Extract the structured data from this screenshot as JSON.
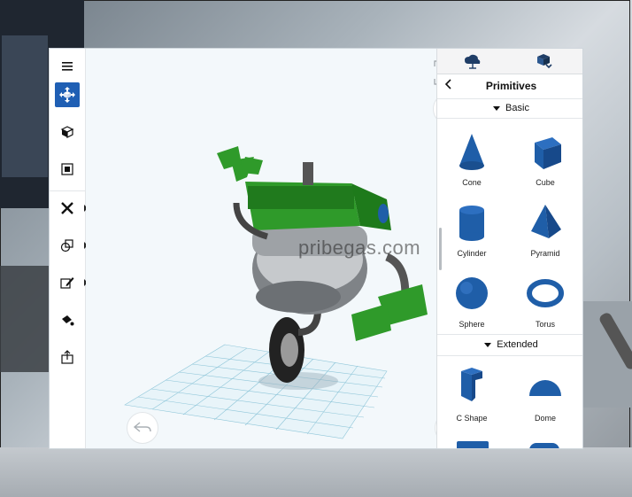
{
  "toolbar": {
    "items": [
      {
        "icon": "menu-icon"
      },
      {
        "icon": "move-icon",
        "active": true
      },
      {
        "icon": "rotate-icon"
      },
      {
        "icon": "scale-icon"
      },
      {
        "icon": "transform-tools-icon",
        "has_submenu": true
      },
      {
        "icon": "combine-icon",
        "has_submenu": true
      },
      {
        "icon": "edit-pen-icon",
        "has_submenu": true
      },
      {
        "icon": "paint-icon"
      },
      {
        "icon": "export-icon"
      }
    ]
  },
  "viewport": {
    "watermark": "pribegas.com",
    "view_cube_icon": "view-cube-icon",
    "undo_icon": "undo-icon",
    "redo_icon": "redo-icon"
  },
  "panel": {
    "tabs": [
      {
        "icon": "cloud-icon"
      },
      {
        "icon": "download-box-icon"
      }
    ],
    "title": "Primitives",
    "basic_label": "Basic",
    "extended_label": "Extended",
    "basic_items": [
      {
        "label": "Cone",
        "icon": "cone-icon"
      },
      {
        "label": "Cube",
        "icon": "cube-icon"
      },
      {
        "label": "Cylinder",
        "icon": "cylinder-icon"
      },
      {
        "label": "Pyramid",
        "icon": "pyramid-icon"
      },
      {
        "label": "Sphere",
        "icon": "sphere-icon"
      },
      {
        "label": "Torus",
        "icon": "torus-icon"
      }
    ],
    "extended_items": [
      {
        "label": "C Shape",
        "icon": "c-shape-icon"
      },
      {
        "label": "Dome",
        "icon": "dome-icon"
      }
    ]
  },
  "colors": {
    "accent": "#1f5fb4",
    "primitive_blue": "#1f5ea8",
    "robot_green": "#2f9a2a"
  }
}
